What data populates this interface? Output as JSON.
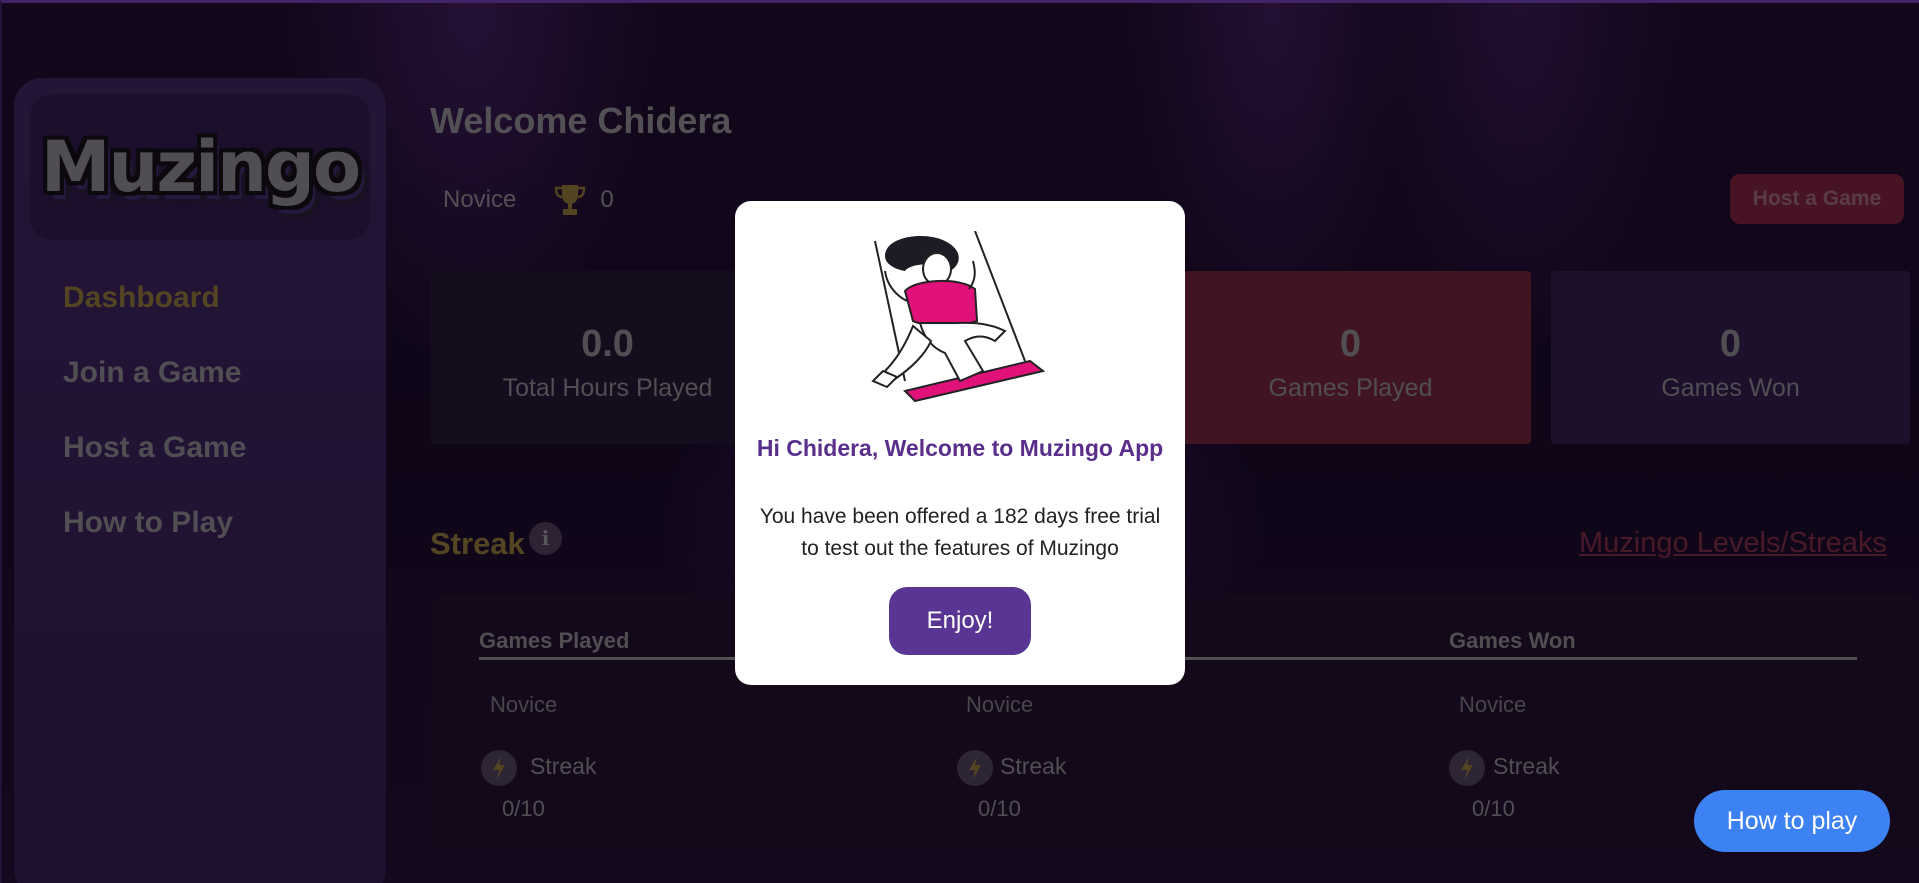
{
  "sidebar": {
    "logo": "Muzingo",
    "items": [
      {
        "label": "Dashboard",
        "active": true
      },
      {
        "label": "Join a Game"
      },
      {
        "label": "Host a Game"
      },
      {
        "label": "How to Play"
      }
    ]
  },
  "header": {
    "welcome": "Welcome Chidera",
    "rank": "Novice",
    "trophies": "0",
    "host_button": "Host a Game"
  },
  "stats": {
    "hours_value": "0.0",
    "hours_label": "Total Hours Played",
    "played_value": "0",
    "played_label": "Games Played",
    "won_value": "0",
    "won_label": "Games Won"
  },
  "streak": {
    "title": "Streak",
    "info_icon": "i",
    "levels_link": "Muzingo Levels/Streaks",
    "columns": [
      {
        "header": "Games Played",
        "level": "Novice",
        "streak_label": "Streak",
        "value": "0/10"
      },
      {
        "header": "",
        "level": "Novice",
        "streak_label": "Streak",
        "value": "0/10"
      },
      {
        "header": "Games Won",
        "level": "Novice",
        "streak_label": "Streak",
        "value": "0/10"
      }
    ]
  },
  "modal": {
    "title": "Hi Chidera, Welcome to Muzingo App",
    "body": "You have been offered a 182 days free trial to test out the features of Muzingo",
    "button": "Enjoy!"
  },
  "help_button": "How to play",
  "colors": {
    "accent_gold": "#8e7a32",
    "modal_purple": "#5a3694",
    "help_blue": "#3d82f2"
  }
}
